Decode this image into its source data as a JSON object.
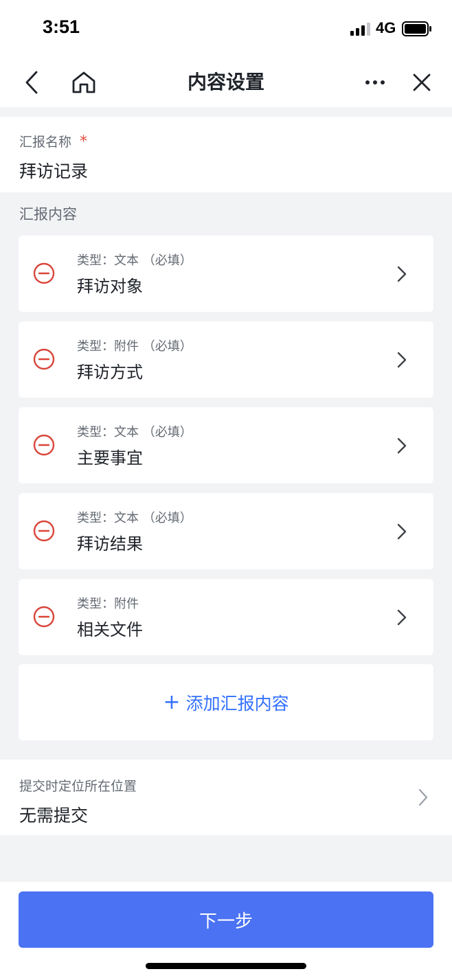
{
  "status_bar": {
    "time": "3:51",
    "network": "4G",
    "signal_icon": "signal-bars-icon",
    "battery_icon": "battery-icon"
  },
  "nav": {
    "title": "内容设置",
    "back_icon": "chevron-left-icon",
    "home_icon": "home-icon",
    "more_icon": "more-dots-icon",
    "close_icon": "close-icon"
  },
  "report_name": {
    "label": "汇报名称",
    "required_mark": "*",
    "value": "拜访记录"
  },
  "report_content": {
    "heading": "汇报内容",
    "items": [
      {
        "type_label": "类型：文本 （必填）",
        "name": "拜访对象"
      },
      {
        "type_label": "类型：附件 （必填）",
        "name": "拜访方式"
      },
      {
        "type_label": "类型：文本 （必填）",
        "name": "主要事宜"
      },
      {
        "type_label": "类型：文本 （必填）",
        "name": "拜访结果"
      },
      {
        "type_label": "类型：附件",
        "name": "相关文件"
      }
    ],
    "add_plus": "+",
    "add_label": "添加汇报内容"
  },
  "location": {
    "label": "提交时定位所在位置",
    "value": "无需提交"
  },
  "footer": {
    "next_label": "下一步"
  },
  "colors": {
    "accent": "#3370ff",
    "primary_button": "#4a72f3",
    "remove": "#d9453a",
    "required": "#e34d3c",
    "background": "#f2f3f5"
  }
}
